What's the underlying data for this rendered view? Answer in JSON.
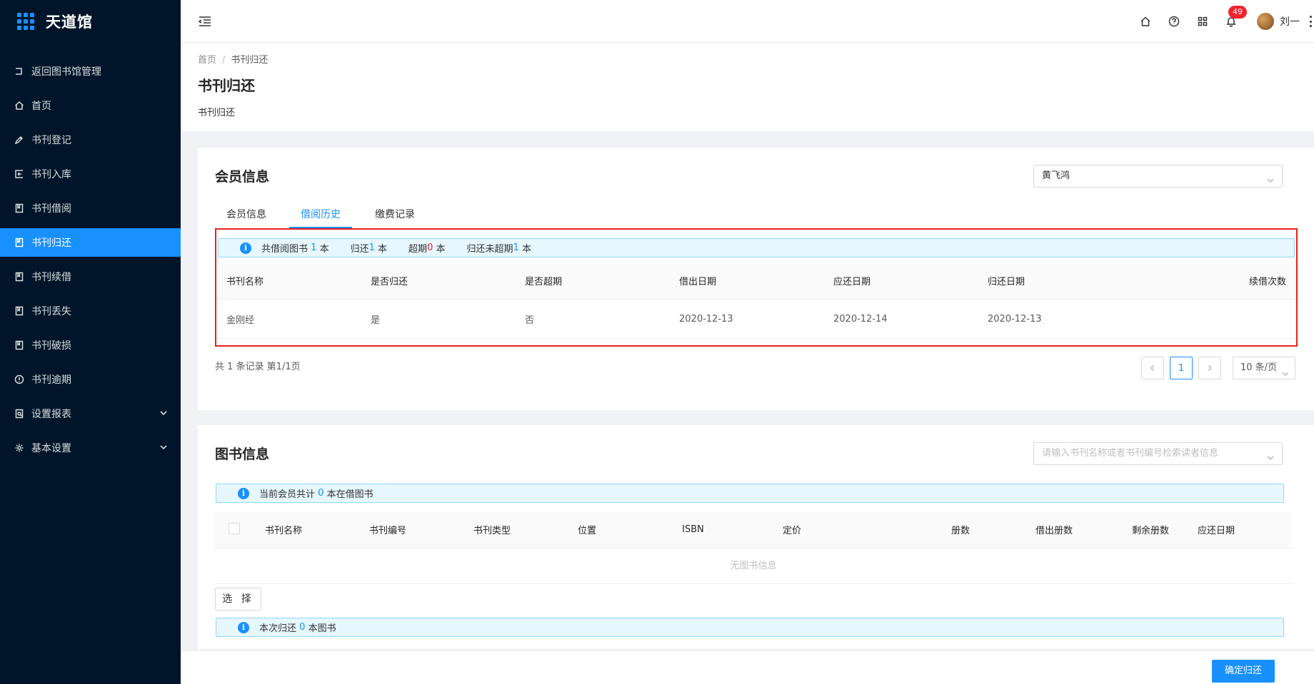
{
  "app": {
    "title": "天道馆"
  },
  "sidebar": {
    "items": [
      {
        "label": "返回图书馆管理",
        "icon": "back-icon"
      },
      {
        "label": "首页",
        "icon": "home-icon"
      },
      {
        "label": "书刊登记",
        "icon": "edit-icon"
      },
      {
        "label": "书刊入库",
        "icon": "import-icon"
      },
      {
        "label": "书刊借阅",
        "icon": "book-icon"
      },
      {
        "label": "书刊归还",
        "icon": "book-icon",
        "active": true
      },
      {
        "label": "书刊续借",
        "icon": "book-icon"
      },
      {
        "label": "书刊丢失",
        "icon": "book-icon"
      },
      {
        "label": "书刊破损",
        "icon": "book-icon"
      },
      {
        "label": "书刊逾期",
        "icon": "info-circle-icon"
      },
      {
        "label": "设置报表",
        "icon": "report-icon",
        "expandable": true
      },
      {
        "label": "基本设置",
        "icon": "gear-icon",
        "expandable": true
      }
    ]
  },
  "header": {
    "notification_count": "49",
    "username": "刘一"
  },
  "page": {
    "breadcrumb": [
      "首页",
      "书刊归还"
    ],
    "title": "书刊归还",
    "description": "书刊归还"
  },
  "member": {
    "title": "会员信息",
    "selected_member": "黄飞鸿",
    "tabs": [
      "会员信息",
      "借阅历史",
      "缴费记录"
    ],
    "active_tab": 1,
    "summary": {
      "borrowed_label": "共借阅图书",
      "borrowed_count": "1",
      "returned_label": "归还",
      "returned_count": "1",
      "overdue_label": "超期",
      "overdue_count": "0",
      "unreturned_label": "归还未超期",
      "unreturned_count": "1",
      "unit": "本"
    },
    "history_columns": [
      "书刊名称",
      "是否归还",
      "是否超期",
      "借出日期",
      "应还日期",
      "归还日期",
      "续借次数"
    ],
    "history_rows": [
      [
        "金刚经",
        "是",
        "否",
        "2020-12-13",
        "2020-12-14",
        "2020-12-13",
        ""
      ]
    ],
    "pagination": {
      "total_text": "共 1 条记录 第1/1页",
      "current_page": "1",
      "page_size": "10 条/页"
    }
  },
  "books": {
    "title": "图书信息",
    "search_placeholder": "请输入书刊名称或者书刊编号检索读者信息",
    "alert_prefix": "当前会员共计",
    "alert_count": "0",
    "alert_suffix": "本在借图书",
    "columns": [
      "书刊名称",
      "书刊编号",
      "书刊类型",
      "位置",
      "ISBN",
      "定价",
      "册数",
      "借出册数",
      "剩余册数",
      "应还日期"
    ],
    "empty_text": "无图书信息",
    "choose_label": "选 择",
    "return_alert_prefix": "本次归还",
    "return_alert_count": "0",
    "return_alert_suffix": "本图书"
  },
  "footer": {
    "confirm_label": "确定归还"
  },
  "colors": {
    "primary": "#1890ff",
    "sidebar_bg": "#001529",
    "danger": "#f5222d",
    "highlight_border": "#e8201a"
  }
}
